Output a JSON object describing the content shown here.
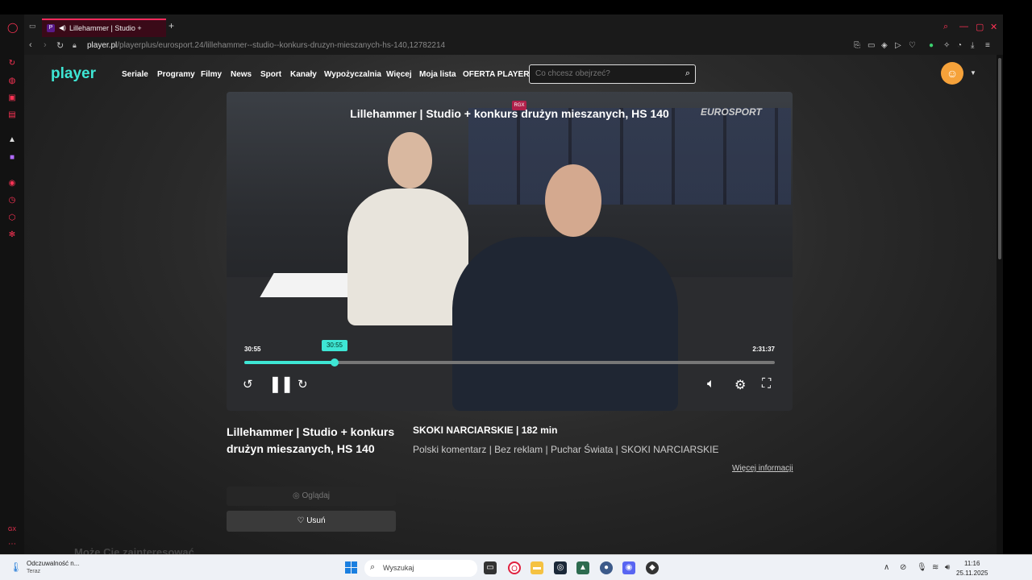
{
  "browser": {
    "tab_title": "Lillehammer | Studio +",
    "url_domain": "player.pl",
    "url_path": "/playerplus/eurosport.24/lillehammer--studio--konkurs-druzyn-mieszanych-hs-140,12782214"
  },
  "site": {
    "logo": "player",
    "menu": [
      "Seriale",
      "Programy",
      "Filmy",
      "News",
      "Sport",
      "Kanały",
      "Wypożyczalnia",
      "Więcej",
      "Moja lista",
      "OFERTA PLAYER"
    ],
    "search_placeholder": "Co chcesz obejrzeć?"
  },
  "player": {
    "video_title": "Lillehammer | Studio + konkurs drużyn mieszanych, HS 140",
    "channel_logo": "EUROSPORT",
    "mini_label": "RGX",
    "current_time": "30:55",
    "tooltip_time": "30:55",
    "total_time": "2:31:37",
    "progress": 0.17
  },
  "info": {
    "title": "Lillehammer | Studio + konkurs drużyn mieszanych, HS 140",
    "category": "SKOKI NARCIARSKIE",
    "duration": "182 min",
    "tags": "Polski komentarz | Bez reklam | Puchar Świata | SKOKI NARCIARSKIE",
    "more_info": "Więcej informacji",
    "watch_label": "Oglądaj",
    "remove_label": "Usuń",
    "recommend_heading": "Może Cię zainteresować"
  },
  "taskbar": {
    "weather_line1": "Odczuwalność n...",
    "weather_line2": "Teraz",
    "search_text": "Wyszukaj",
    "time": "11:16",
    "date": "25.11.2025"
  }
}
